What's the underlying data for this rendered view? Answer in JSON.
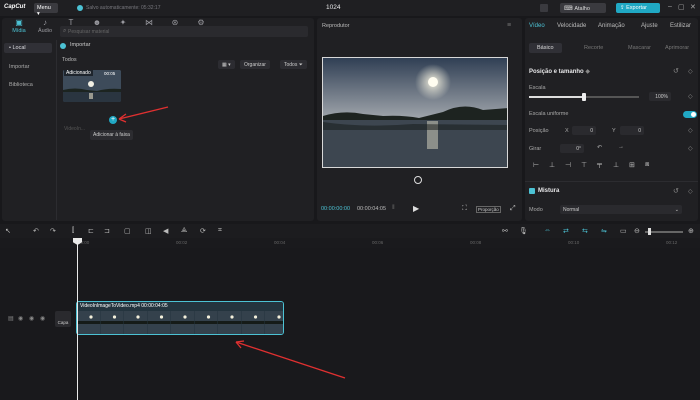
{
  "app": {
    "logo": "CapCut",
    "menu_label": "Menu ▾",
    "save_status": "Salvo automaticamente: 05:32:17",
    "project_title": "1024",
    "shortcut_label": "Atalho",
    "export_label": "Exportar"
  },
  "media_panel": {
    "tabs": [
      {
        "label": "Mídia",
        "icon": "media-icon"
      },
      {
        "label": "Áudio",
        "icon": "audio-icon"
      },
      {
        "label": "Texto",
        "icon": "text-icon"
      },
      {
        "label": "Stickers",
        "icon": "sticker-icon"
      },
      {
        "label": "Efeitos",
        "icon": "effects-icon"
      },
      {
        "label": "Transições",
        "icon": "transitions-icon"
      },
      {
        "label": "Filtros",
        "icon": "filters-icon"
      },
      {
        "label": "Ajuste",
        "icon": "adjust-icon"
      }
    ],
    "sidebar": [
      "• Local",
      "Importar",
      "Biblioteca"
    ],
    "search_placeholder": "Pesquisar material",
    "import_label": "Importar",
    "organize_label": "Organizar",
    "all_filter_label": "Todos",
    "section_label": "Todos",
    "thumbnail": {
      "badge": "Adicionado",
      "duration": "00:05",
      "name": "VideoIn..."
    },
    "tooltip": "Adicionar à faixa"
  },
  "player": {
    "title": "Reprodutor",
    "timecode_current": "00:00:00:00",
    "timecode_total": "00:00:04:05",
    "ratio_label": "Proporção"
  },
  "inspector": {
    "tabs": [
      "Vídeo",
      "Velocidade",
      "Animação",
      "Ajuste",
      "Estilizar"
    ],
    "subtabs": [
      "Básico",
      "Recorte",
      "Mascarar",
      "Aprimorar"
    ],
    "position_size_title": "Posição e tamanho",
    "scale_label": "Escala",
    "scale_value": "100%",
    "scale_fraction": 0.5,
    "uniform_scale_label": "Escala uniforme",
    "position_label": "Posição",
    "pos_x_label": "X",
    "pos_x": "0",
    "pos_y_label": "Y",
    "pos_y": "0",
    "rotate_label": "Girar",
    "rotate_value": "0°",
    "blend_title": "Mistura",
    "mode_label": "Modo",
    "mode_value": "Normal"
  },
  "timeline": {
    "ruler": [
      "00:00",
      "00:02",
      "00:04",
      "00:06",
      "00:08",
      "00:10",
      "00:12"
    ],
    "cover_label": "Capa",
    "clip_label": "VideoInImageToVideo.mp4   00:00:04:05"
  },
  "colors": {
    "accent": "#4cc2d4",
    "export": "#20a8c4",
    "annotation_arrow": "#e03030"
  }
}
